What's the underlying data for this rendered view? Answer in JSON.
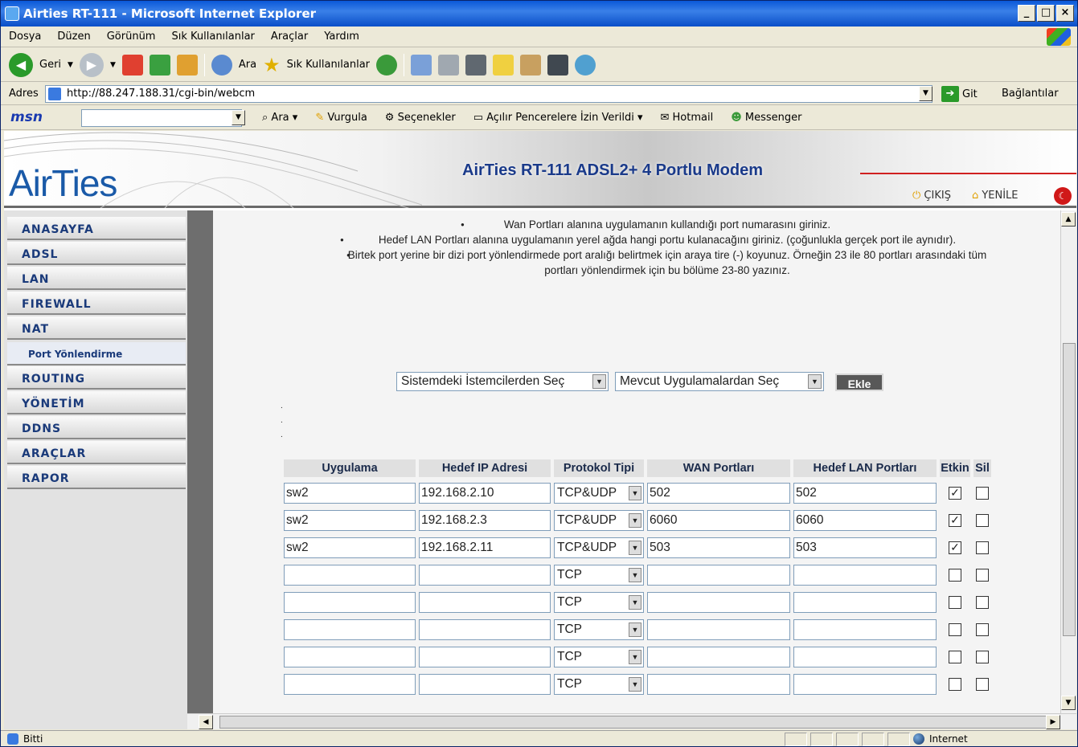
{
  "window": {
    "title": "Airties RT-111 - Microsoft Internet Explorer",
    "controls": [
      "_",
      "□",
      "×"
    ]
  },
  "menu": [
    "Dosya",
    "Düzen",
    "Görünüm",
    "Sık Kullanılanlar",
    "Araçlar",
    "Yardım"
  ],
  "toolbar": {
    "back": "Geri",
    "search": "Ara",
    "favorites": "Sık Kullanılanlar"
  },
  "address": {
    "label": "Adres",
    "url": "http://88.247.188.31/cgi-bin/webcm",
    "go": "Git",
    "links": "Bağlantılar"
  },
  "msnbar": {
    "logo": "msn",
    "search": "Ara",
    "highlight": "Vurgula",
    "options": "Seçenekler",
    "popups": "Açılır Pencerelere İzin Verildi",
    "hotmail": "Hotmail",
    "messenger": "Messenger"
  },
  "header": {
    "brand": "AirTies",
    "title": "AirTies RT-111 ADSL2+ 4 Portlu Modem",
    "logout": "ÇIKIŞ",
    "refresh": "YENİLE"
  },
  "sidebar": {
    "items": [
      "ANASAYFA",
      "ADSL",
      "LAN",
      "FIREWALL",
      "NAT",
      "Port Yönlendirme",
      "ROUTING",
      "YÖNETİM",
      "DDNS",
      "ARAÇLAR",
      "RAPOR"
    ]
  },
  "notes": {
    "n1": "Wan Portları alanına uygulamanın kullandığı port numarasını giriniz.",
    "n2": "Hedef LAN Portları alanına uygulamanın yerel ağda hangi portu kulanacağını giriniz. (çoğunlukla gerçek port ile aynıdır).",
    "n3": "Birtek port yerine bir dizi port yönlendirmede port aralığı belirtmek için araya tire (-) koyunuz. Örneğin 23 ile 80 portları arasındaki tüm portları yönlendirmek için bu bölüme 23-80 yazınız."
  },
  "selectors": {
    "clients": "Sistemdeki İstemcilerden Seç",
    "apps": "Mevcut Uygulamalardan Seç",
    "add": "Ekle"
  },
  "table": {
    "headers": [
      "Uygulama",
      "Hedef IP Adresi",
      "Protokol Tipi",
      "WAN Portları",
      "Hedef LAN Portları",
      "Etkin",
      "Sil"
    ],
    "rows": [
      {
        "app": "sw2",
        "ip": "192.168.2.10",
        "proto": "TCP&UDP",
        "wan": "502",
        "lan": "502",
        "enabled": true,
        "del": false
      },
      {
        "app": "sw2",
        "ip": "192.168.2.3",
        "proto": "TCP&UDP",
        "wan": "6060",
        "lan": "6060",
        "enabled": true,
        "del": false
      },
      {
        "app": "sw2",
        "ip": "192.168.2.11",
        "proto": "TCP&UDP",
        "wan": "503",
        "lan": "503",
        "enabled": true,
        "del": false
      },
      {
        "app": "",
        "ip": "",
        "proto": "TCP",
        "wan": "",
        "lan": "",
        "enabled": false,
        "del": false
      },
      {
        "app": "",
        "ip": "",
        "proto": "TCP",
        "wan": "",
        "lan": "",
        "enabled": false,
        "del": false
      },
      {
        "app": "",
        "ip": "",
        "proto": "TCP",
        "wan": "",
        "lan": "",
        "enabled": false,
        "del": false
      },
      {
        "app": "",
        "ip": "",
        "proto": "TCP",
        "wan": "",
        "lan": "",
        "enabled": false,
        "del": false
      },
      {
        "app": "",
        "ip": "",
        "proto": "TCP",
        "wan": "",
        "lan": "",
        "enabled": false,
        "del": false
      }
    ]
  },
  "status": {
    "left": "Bitti",
    "zone": "Internet"
  }
}
